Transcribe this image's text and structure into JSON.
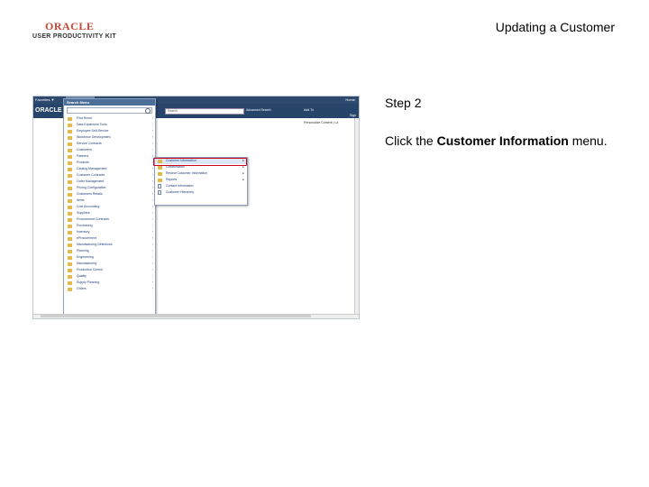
{
  "header": {
    "logo_word": "ORACLE",
    "logo_sub": "USER PRODUCTIVITY KIT",
    "doc_title": "Updating a Customer"
  },
  "step": {
    "label": "Step 2",
    "instruction_prefix": "Click the ",
    "instruction_bold": "Customer Information",
    "instruction_suffix": " menu."
  },
  "screenshot": {
    "topbar": {
      "favorites": "Favorites ▼",
      "main_menu": "Main Menu",
      "home": "Home"
    },
    "banner": {
      "brand": "ORACLE",
      "search_placeholder": "Search",
      "advanced_search": "Advanced Search",
      "add_to": "Add To",
      "right_link": "Sign"
    },
    "subline": "Personalize Content | La",
    "menu_panel": {
      "title": "Search Menu",
      "items": [
        "Find Home",
        "Data Expansion Tools",
        "Employee Self-Service",
        "Workforce Development",
        "Service Contracts",
        "Customers",
        "Partners",
        "Products",
        "Catalog Management",
        "Customer Contracts",
        "Order Management",
        "Pricing Configuration",
        "Customers Retails",
        "Items",
        "Cost Accounting",
        "Suppliers",
        "Procurement Contracts",
        "Purchasing",
        "Inventory",
        "eProcurement",
        "Manufacturing Definitions",
        "Planning",
        "Engineering",
        "Manufacturing",
        "Production Control",
        "Quality",
        "Supply Planning",
        "Orders"
      ]
    },
    "submenu": {
      "items": [
        {
          "label": "Customer Information",
          "icon": "folder-icon",
          "has_arrow": true,
          "highlighted": true
        },
        {
          "label": "Collaboration",
          "icon": "folder-icon",
          "has_arrow": true
        },
        {
          "label": "Review Customer Information",
          "icon": "folder-icon",
          "has_arrow": true
        },
        {
          "label": "Reports",
          "icon": "folder-icon",
          "has_arrow": true
        },
        {
          "label": "Contact Information",
          "icon": "document-icon",
          "has_arrow": false
        },
        {
          "label": "Customer Hierarchy",
          "icon": "document-icon",
          "has_arrow": false
        }
      ]
    }
  },
  "colors": {
    "highlight_border": "#d0021b",
    "banner": "#27456b",
    "oracle_red": "#c74634"
  }
}
